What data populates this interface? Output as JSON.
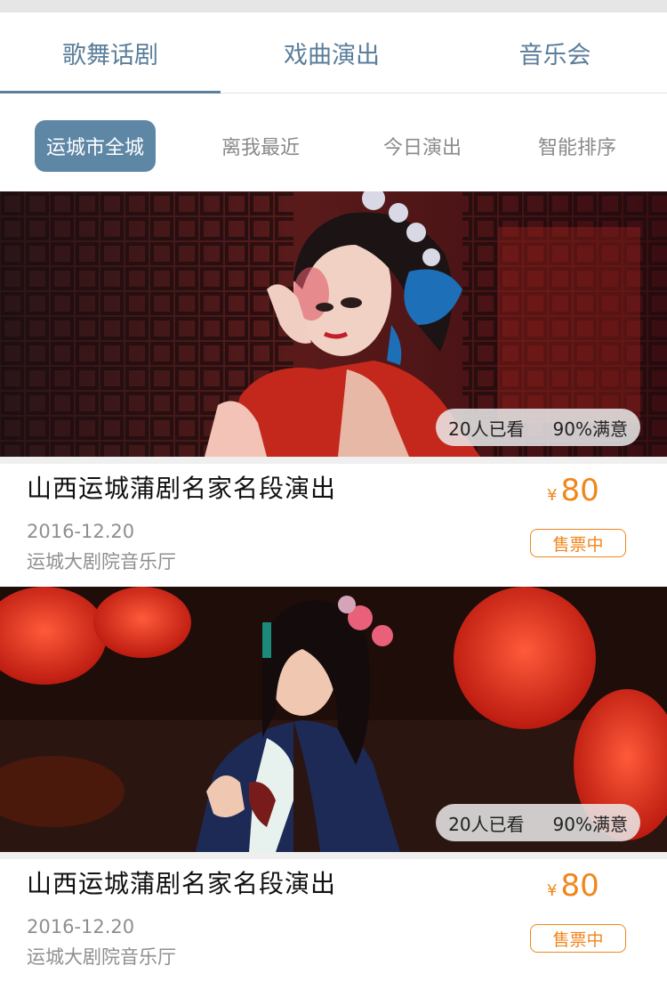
{
  "tabs": [
    {
      "label": "歌舞话剧",
      "active": true
    },
    {
      "label": "戏曲演出",
      "active": false
    },
    {
      "label": "音乐会",
      "active": false
    }
  ],
  "filters": [
    {
      "label": "运城市全城",
      "active": true
    },
    {
      "label": "离我最近",
      "active": false
    },
    {
      "label": "今日演出",
      "active": false
    },
    {
      "label": "智能排序",
      "active": false
    }
  ],
  "events": [
    {
      "poster_icon": "opera-performer-photo",
      "views": "20人已看",
      "satisfaction": "90%满意",
      "title": "山西运城蒲剧名家名段演出",
      "date": "2016-12.20",
      "venue": "运城大剧院音乐厅",
      "currency": "¥",
      "price": "80",
      "status": "售票中"
    },
    {
      "poster_icon": "opera-performer-lanterns-photo",
      "views": "20人已看",
      "satisfaction": "90%满意",
      "title": "山西运城蒲剧名家名段演出",
      "date": "2016-12.20",
      "venue": "运城大剧院音乐厅",
      "currency": "¥",
      "price": "80",
      "status": "售票中"
    }
  ],
  "colors": {
    "accent": "#5b7e9a",
    "filter_active_bg": "#5e87a6",
    "price": "#f0861b"
  }
}
